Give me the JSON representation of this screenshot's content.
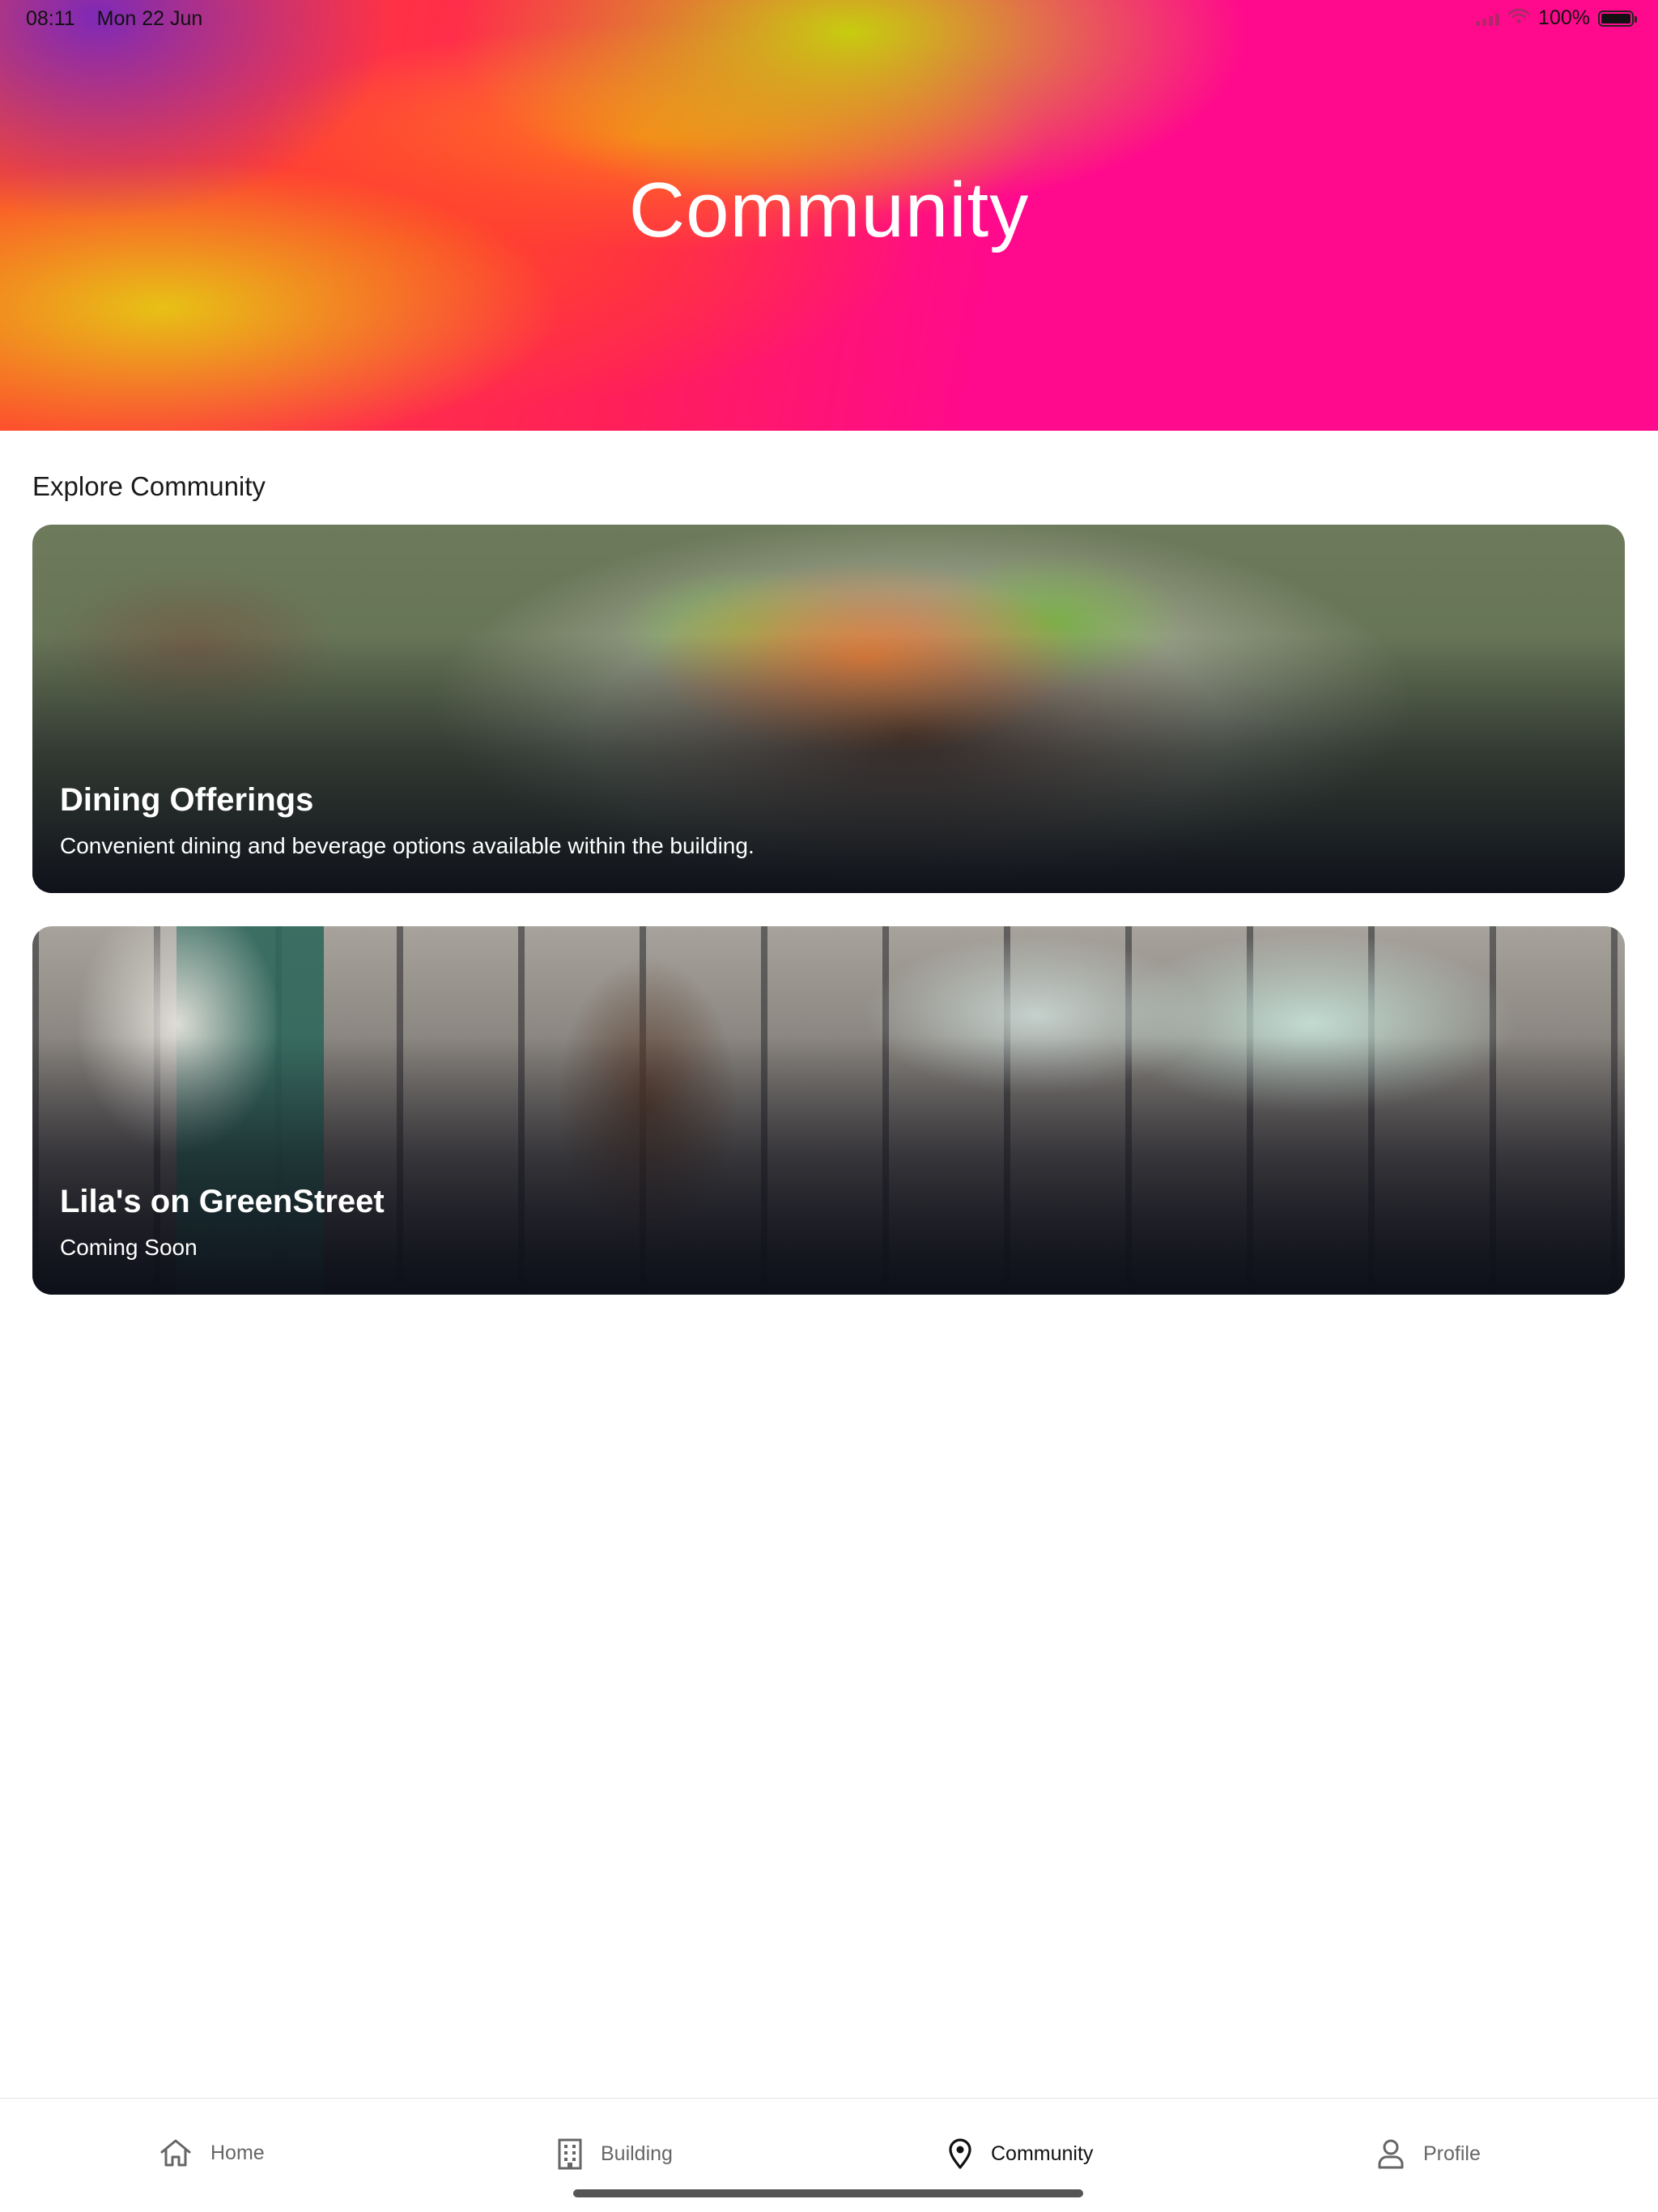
{
  "status_bar": {
    "time": "08:11",
    "date": "Mon 22 Jun",
    "battery": "100%"
  },
  "header": {
    "title": "Community"
  },
  "explore": {
    "section_title": "Explore Community",
    "cards": [
      {
        "title": "Dining Offerings",
        "subtitle": "Convenient dining and beverage options available within the building."
      },
      {
        "title": "Lila's on GreenStreet",
        "subtitle": "Coming Soon"
      }
    ]
  },
  "tab_bar": {
    "tabs": [
      {
        "label": "Home",
        "icon": "home-icon",
        "active": false
      },
      {
        "label": "Building",
        "icon": "building-icon",
        "active": false
      },
      {
        "label": "Community",
        "icon": "map-pin-icon",
        "active": true
      },
      {
        "label": "Profile",
        "icon": "person-icon",
        "active": false
      }
    ]
  }
}
